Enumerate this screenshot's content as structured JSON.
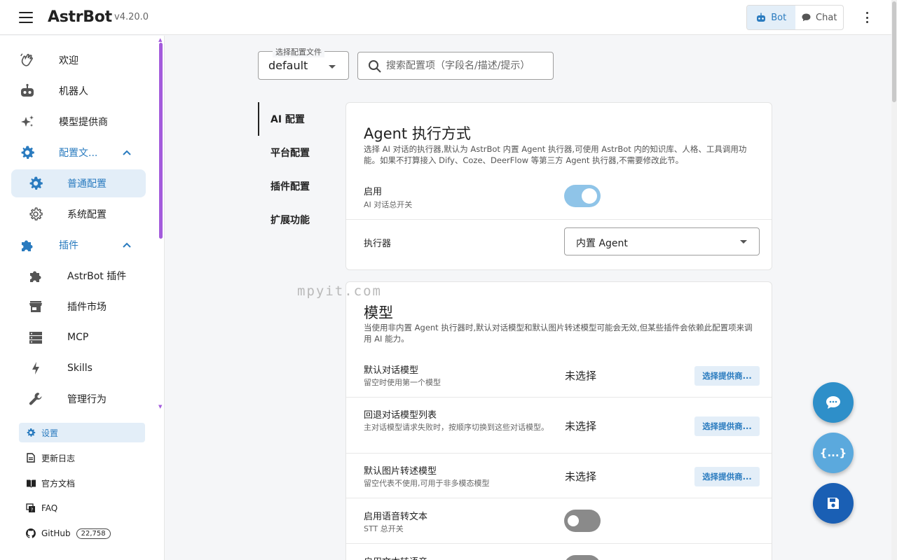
{
  "header": {
    "brand": "AstrBot",
    "version": "v4.20.0",
    "mode_bot": "Bot",
    "mode_chat": "Chat"
  },
  "sidebar": {
    "items": [
      {
        "label": "欢迎",
        "icon": "hand-wave-icon"
      },
      {
        "label": "机器人",
        "icon": "robot-icon"
      },
      {
        "label": "模型提供商",
        "icon": "sparkles-icon"
      },
      {
        "label": "配置文...",
        "icon": "gear-icon"
      },
      {
        "label": "普通配置",
        "icon": "gear-icon"
      },
      {
        "label": "系统配置",
        "icon": "gear-outline-icon"
      },
      {
        "label": "插件",
        "icon": "puzzle-icon"
      },
      {
        "label": "AstrBot 插件",
        "icon": "puzzle-icon"
      },
      {
        "label": "插件市场",
        "icon": "store-icon"
      },
      {
        "label": "MCP",
        "icon": "server-icon"
      },
      {
        "label": "Skills",
        "icon": "lightning-icon"
      },
      {
        "label": "管理行为",
        "icon": "wrench-icon"
      }
    ],
    "bottom": {
      "settings": "设置",
      "changelog": "更新日志",
      "docs": "官方文档",
      "faq": "FAQ",
      "github": "GitHub",
      "github_count": "22,758"
    }
  },
  "main": {
    "config_select_legend": "选择配置文件",
    "config_select_value": "default",
    "search_placeholder": "搜索配置项（字段名/描述/提示）",
    "tabs": [
      "AI 配置",
      "平台配置",
      "插件配置",
      "扩展功能"
    ],
    "agent_card": {
      "title": "Agent 执行方式",
      "desc": "选择 AI 对话的执行器,默认为 AstrBot 内置 Agent 执行器,可使用 AstrBot 内的知识库、人格、工具调用功能。如果不打算接入 Dify、Coze、DeerFlow 等第三方 Agent 执行器,不需要修改此节。",
      "enable_label": "启用",
      "enable_hint": "AI 对话总开关",
      "enable_on": true,
      "executor_label": "执行器",
      "executor_value": "内置 Agent"
    },
    "model_card": {
      "title": "模型",
      "desc": "当使用非内置 Agent 执行器时,默认对话模型和默认图片转述模型可能会无效,但某些插件会依赖此配置项来调用 AI 能力。",
      "unselected": "未选择",
      "choose_provider": "选择提供商...",
      "default_chat_label": "默认对话模型",
      "default_chat_hint": "留空时使用第一个模型",
      "fallback_label": "回退对话模型列表",
      "fallback_hint": "主对话模型请求失败时，按顺序切换到这些对话模型。",
      "image_label": "默认图片转述模型",
      "image_hint": "留空代表不使用,可用于非多模态模型",
      "stt_label": "启用语音转文本",
      "stt_hint": "STT 总开关",
      "stt_on": false,
      "tts_label": "启用文本转语音"
    },
    "watermark": "mpyit.com",
    "fab_json": "{...}"
  },
  "colors": {
    "accent": "#2a7bbf",
    "active_bg": "#e3eef8",
    "sidebar_scroll": "#a35bdc",
    "fab_chat": "#2e8fc9",
    "fab_json": "#5ba9dd",
    "fab_save": "#1a5fb4"
  }
}
